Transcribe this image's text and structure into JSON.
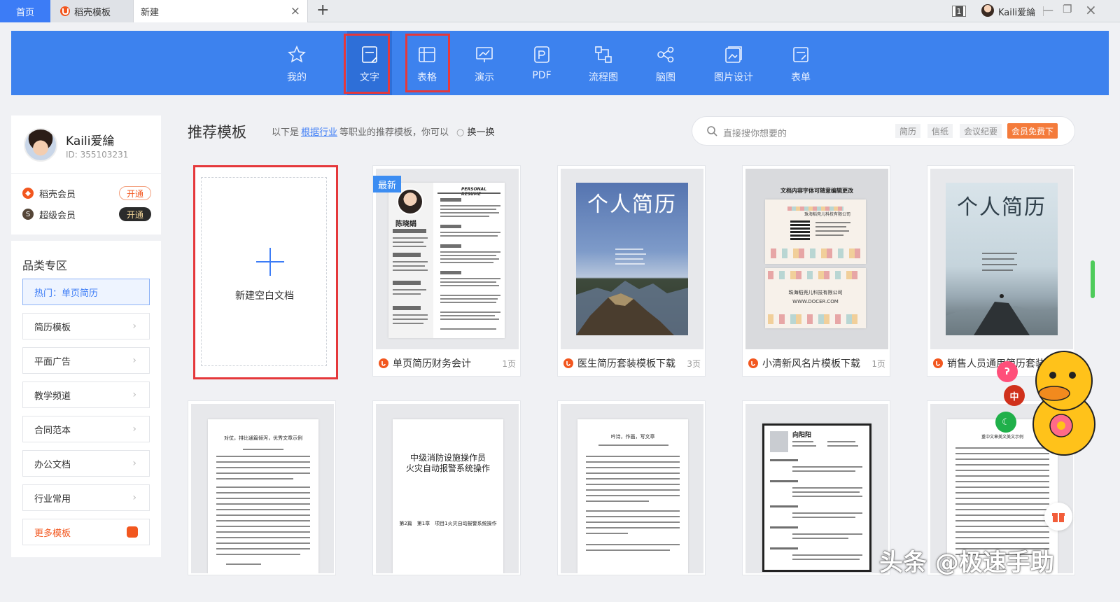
{
  "tabs": {
    "home": "首页",
    "docer": "稻壳模板",
    "new": "新建",
    "close": "×",
    "add": "+"
  },
  "window": {
    "tab_count": "1",
    "user": "Kaili爱綸",
    "minimize": "—",
    "restore": "❐",
    "close": "×"
  },
  "toolbar": {
    "items": [
      {
        "label": "我的",
        "icon": "star-icon"
      },
      {
        "label": "文字",
        "icon": "document-icon"
      },
      {
        "label": "表格",
        "icon": "table-icon"
      },
      {
        "label": "演示",
        "icon": "presentation-icon"
      },
      {
        "label": "PDF",
        "icon": "pdf-icon"
      },
      {
        "label": "流程图",
        "icon": "flowchart-icon"
      },
      {
        "label": "脑图",
        "icon": "mindmap-icon"
      },
      {
        "label": "图片设计",
        "icon": "image-design-icon"
      },
      {
        "label": "表单",
        "icon": "form-icon"
      }
    ],
    "active": "文字",
    "colors": {
      "bar": "#3d82ee",
      "highlight": "#e5383b"
    }
  },
  "profile": {
    "name": "Kaili爱綸",
    "id": "ID: 355103231",
    "members": [
      {
        "label": "稻壳会员",
        "action": "开通"
      },
      {
        "label": "超级会员",
        "action": "开通"
      }
    ]
  },
  "category": {
    "title": "品类专区",
    "items": [
      "热门：单页简历",
      "简历模板",
      "平面广告",
      "教学频道",
      "合同范本",
      "办公文档",
      "行业常用",
      "更多模板"
    ],
    "chevron": "›"
  },
  "main": {
    "title": "推荐模板",
    "subtitle_pre": "以下是",
    "subtitle_link": "根据行业",
    "subtitle_post": "等职业的推荐模板，你可以",
    "refresh": "换一换",
    "search_placeholder": "直接搜你想要的",
    "chips": [
      "简历",
      "信纸",
      "会议纪要"
    ],
    "vip_button": "会员免费下"
  },
  "cards": {
    "blank": "新建空白文档",
    "badge_new": "最新",
    "row1": [
      {
        "title": "单页简历财务会计",
        "pages": "1页"
      },
      {
        "title": "医生简历套装模板下载",
        "pages": "3页"
      },
      {
        "title": "小清新风名片模板下载",
        "pages": "1页"
      },
      {
        "title": "销售人员通用简历套装",
        "pages": ""
      }
    ],
    "resume_name": "陈晓娟",
    "resume_header": "PERSONAL RESUME",
    "poster_title": "个人简历",
    "namecard_top": "文档内容字体可随意编辑更改",
    "namecard_company": "珠海稻壳儿科技有限公司",
    "namecard_web": "WWW.DOCER.COM",
    "row2": [
      {
        "heading": "对仗，排比通篇倾泻，优秀文章示例"
      },
      {
        "heading": "中级消防设施操作员\n火灾自动报警系统操作",
        "sub": "第2篇　第1章　项目1火灾自动报警系统操作"
      },
      {
        "heading": "吟诗，作画，写文章"
      },
      {
        "heading": "向阳阳"
      },
      {
        "heading": "重中文章美文美文示例"
      }
    ]
  },
  "overlay": {
    "float_buttons": [
      "中"
    ],
    "watermark": "头条 @极速手助"
  }
}
